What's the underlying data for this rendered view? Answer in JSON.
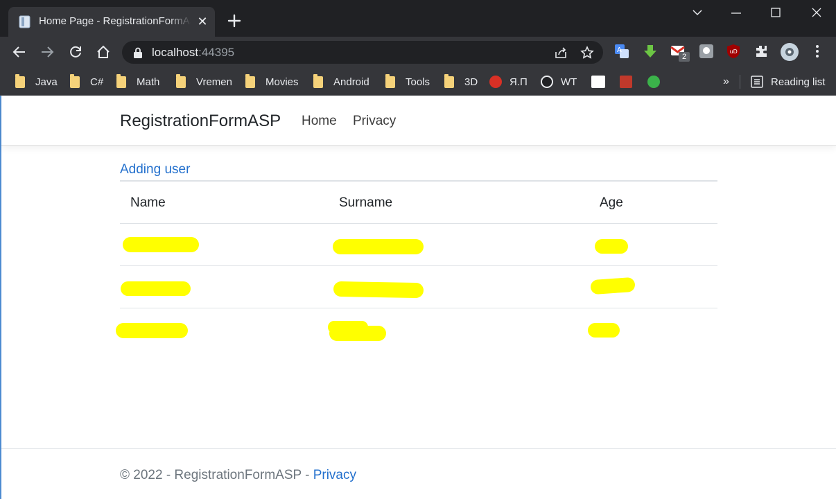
{
  "browser": {
    "tab_title": "Home Page - RegistrationFormASP",
    "url_host": "localhost",
    "url_port": ":44395",
    "bookmarks": [
      "Java",
      "C#",
      "Math",
      "Vremen",
      "Movies",
      "Android",
      "Tools",
      "3D"
    ],
    "bookmark_yap": "Я.П",
    "bookmark_wt": "WT",
    "ext_badge": "2",
    "overflow": "»",
    "reading_list": "Reading list"
  },
  "site": {
    "brand": "RegistrationFormASP",
    "nav": [
      "Home",
      "Privacy"
    ],
    "add_link": "Adding user",
    "table": {
      "headers": [
        "Name",
        "Surname",
        "Age"
      ],
      "rows": [
        {
          "name": "",
          "surname": "",
          "age": ""
        },
        {
          "name": "",
          "surname": "",
          "age": ""
        },
        {
          "name": "",
          "surname": "",
          "age": ""
        }
      ]
    },
    "footer": {
      "text": "© 2022 - RegistrationFormASP - ",
      "link": "Privacy"
    }
  },
  "colors": {
    "chrome_dark": "#202124",
    "chrome_toolbar": "#35363a",
    "link_blue": "#2370cd",
    "redaction": "#ffff00"
  }
}
